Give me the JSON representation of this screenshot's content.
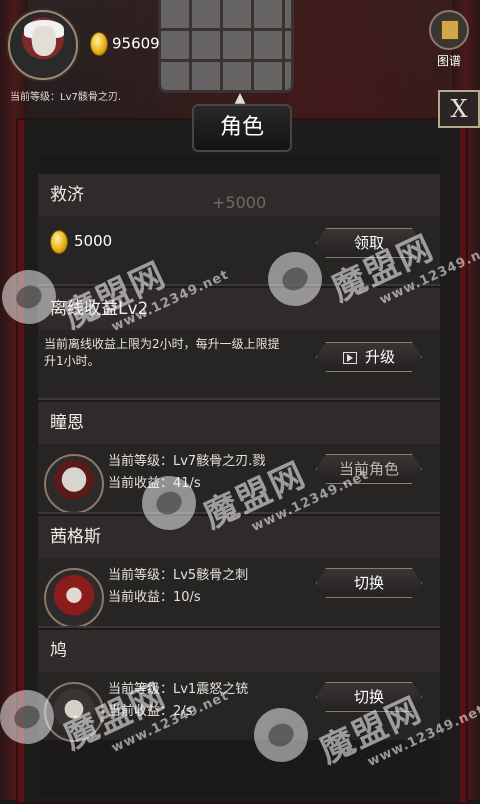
{
  "header": {
    "gold": "95609",
    "level_caption": "当前等级：Lv7骸骨之刃.",
    "codex_label": "图谱"
  },
  "panel": {
    "title": "角色",
    "close_label": "X"
  },
  "relief": {
    "title": "救济",
    "bonus": "+5000",
    "amount": "5000",
    "button": "领取"
  },
  "offline": {
    "title": "离线收益Lv2",
    "description": "当前离线收益上限为2小时，每升一级上限提升1小时。",
    "button": "升级"
  },
  "heroes": [
    {
      "name": "瞳恩",
      "level": "当前等级：Lv7骸骨之刃.戮",
      "income": "当前收益：41/s",
      "button": "当前角色"
    },
    {
      "name": "茜格斯",
      "level": "当前等级：Lv5骸骨之刺",
      "income": "当前收益：10/s",
      "button": "切换"
    },
    {
      "name": "鸠",
      "level": "当前等级：Lv1震怒之铳",
      "income": "当前收益：2/s",
      "button": "切换"
    }
  ],
  "watermark": {
    "text": "魔盟网",
    "url": "www.12349.net"
  },
  "colors": {
    "panel_frame": "#5a0f12",
    "card": "#272424",
    "gold": "#e9b21a"
  },
  "icons": {
    "gold": "gold-coin-icon",
    "codex": "book-icon",
    "video": "video-ad-icon"
  }
}
